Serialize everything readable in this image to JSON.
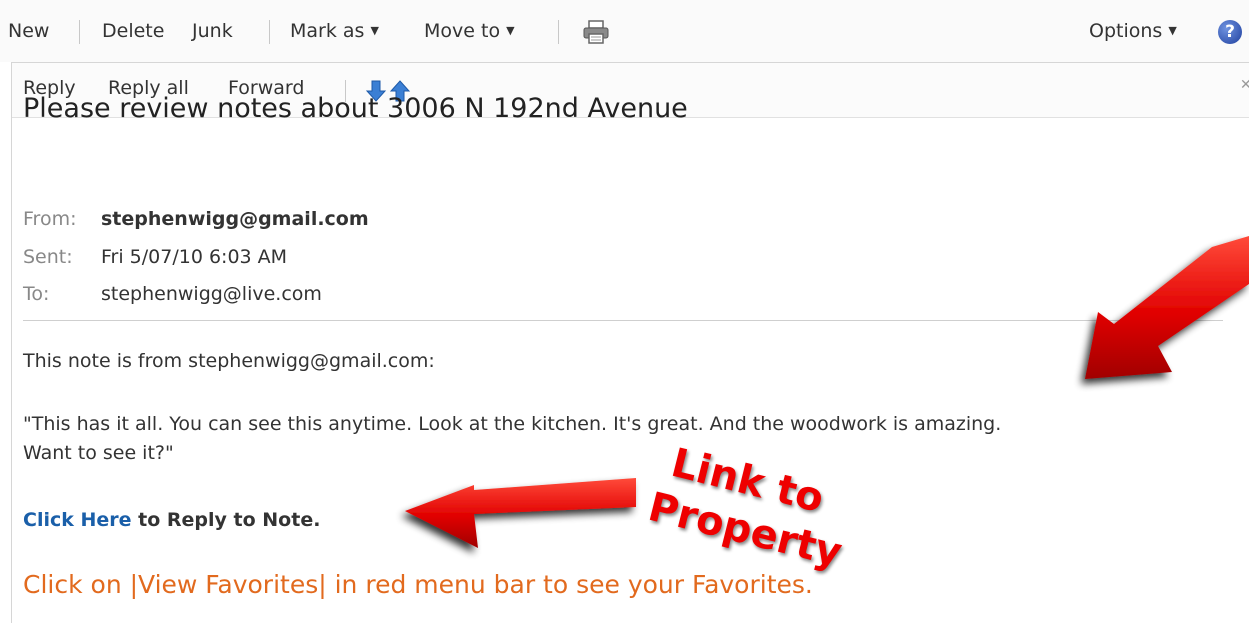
{
  "toolbar": {
    "new": "New",
    "delete": "Delete",
    "junk": "Junk",
    "mark_as": "Mark as",
    "move_to": "Move to",
    "options": "Options",
    "help": "?"
  },
  "message_toolbar": {
    "reply": "Reply",
    "reply_all": "Reply all",
    "forward": "Forward"
  },
  "message": {
    "subject": "Please review notes about 3006 N 192nd Avenue",
    "from_label": "From:",
    "from_value": "stephenwigg@gmail.com",
    "sent_label": "Sent:",
    "sent_value": "Fri 5/07/10 6:03 AM",
    "to_label": "To:",
    "to_value": "stephenwigg@live.com",
    "intro": "This note is from stephenwigg@gmail.com:",
    "quote_line1": "\"This has it all. You can see this anytime. Look at the kitchen. It's great. And the woodwork is amazing.",
    "quote_line2": "Want to see it?\"",
    "click_here": "Click Here",
    "reply_suffix": " to Reply to Note.",
    "favorites_note": "Click on |View Favorites| in red menu bar to see your Favorites."
  },
  "annotation": {
    "line1": "Link to",
    "line2": "Property",
    "color": "#ee0000"
  },
  "colors": {
    "link": "#1a5fa9",
    "orange_text": "#e26a1e"
  },
  "icons": [
    "printer-icon",
    "down-arrow-icon",
    "up-arrow-icon",
    "help-icon",
    "close-icon"
  ]
}
